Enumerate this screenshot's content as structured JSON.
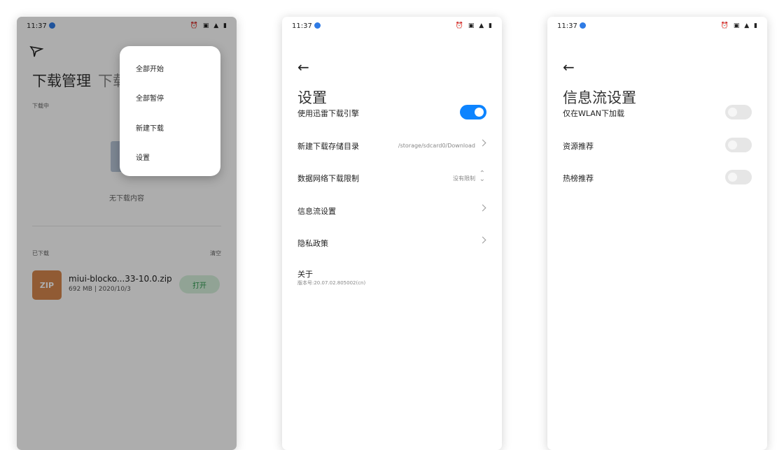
{
  "status": {
    "time": "11:37",
    "icons": "⏰ ▣ ▲ ▮"
  },
  "screen1": {
    "title": "下载管理",
    "title_partial": "下载",
    "downloading_label": "下载中",
    "empty_text": "无下载内容",
    "downloaded_label": "已下载",
    "clear_label": "清空",
    "file": {
      "icon_text": "ZIP",
      "name": "miui-blocko...33-10.0.zip",
      "meta": "692 MB | 2020/10/3",
      "open_label": "打开"
    },
    "menu": [
      "全部开始",
      "全部暂停",
      "新建下载",
      "设置"
    ]
  },
  "screen2": {
    "title": "设置",
    "rows": [
      {
        "label": "使用迅雷下载引擎"
      },
      {
        "label": "新建下载存储目录",
        "value": "/storage/sdcard0/Download"
      },
      {
        "label": "数据网络下载限制",
        "value": "没有限制"
      },
      {
        "label": "信息流设置"
      },
      {
        "label": "隐私政策"
      }
    ],
    "about": "关于",
    "version": "版本号:20.07.02.805002(cn)"
  },
  "screen3": {
    "title": "信息流设置",
    "rows": [
      {
        "label": "仅在WLAN下加载"
      },
      {
        "label": "资源推荐"
      },
      {
        "label": "热榜推荐"
      }
    ]
  },
  "colors": {
    "accent": "#0d84ff",
    "zip": "#d6874d",
    "open_button": "#d6f0dc"
  },
  "icons": [
    "back-arrow-icon",
    "app-logo-icon",
    "cloud-icon",
    "chevron-right-icon"
  ]
}
